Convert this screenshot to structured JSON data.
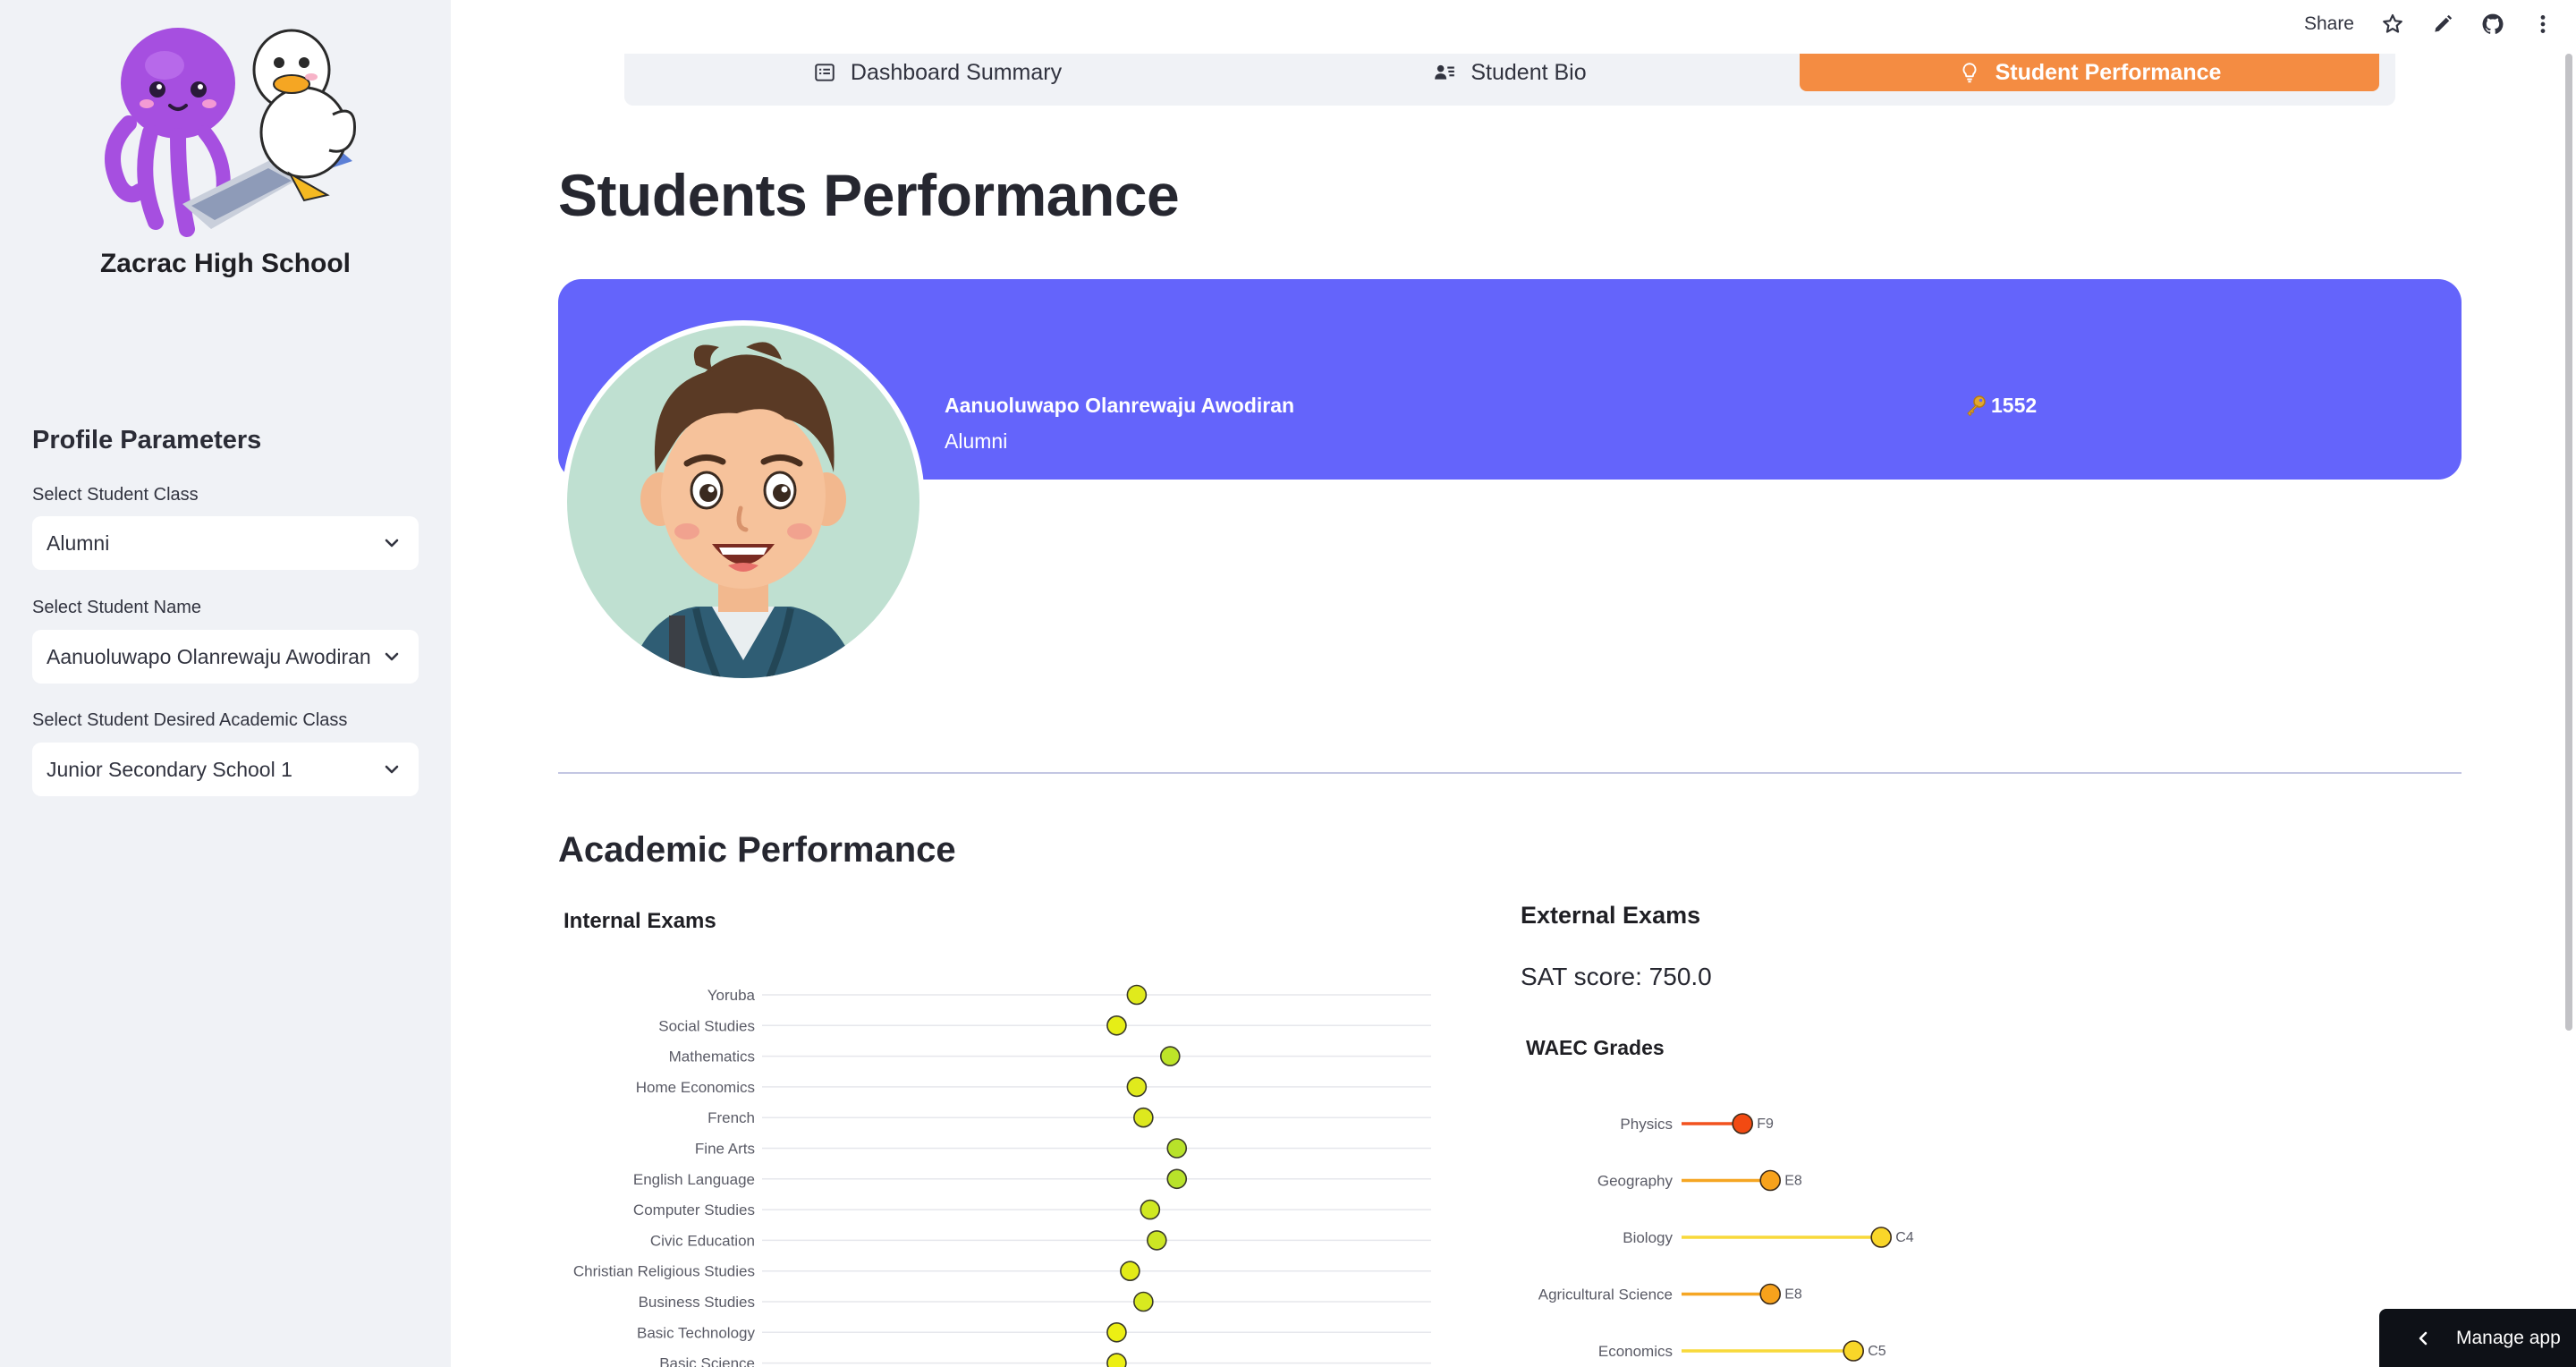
{
  "sidebar": {
    "school_name": "Zacrac High School",
    "profile_heading": "Profile Parameters",
    "fields": [
      {
        "label": "Select Student Class",
        "value": "Alumni"
      },
      {
        "label": "Select Student Name",
        "value": "Aanuoluwapo Olanrewaju Awodiran"
      },
      {
        "label": "Select Student Desired Academic Class",
        "value": "Junior Secondary School 1"
      }
    ]
  },
  "toolbar": {
    "share_label": "Share",
    "icons": [
      "star-icon",
      "edit-icon",
      "github-icon",
      "more-icon"
    ]
  },
  "tabs": [
    {
      "label": "Dashboard Summary",
      "icon": "summary-icon",
      "active": false
    },
    {
      "label": "Student Bio",
      "icon": "bio-icon",
      "active": false
    },
    {
      "label": "Student Performance",
      "icon": "lightbulb-icon",
      "active": true
    }
  ],
  "page": {
    "title": "Students Performance"
  },
  "profile": {
    "name": "Aanuoluwapo Olanrewaju Awodiran",
    "class": "Alumni",
    "student_id": "1552",
    "card_color": "#6464fb"
  },
  "academic": {
    "heading": "Academic Performance",
    "internal_title": "Internal Exams",
    "external_title": "External Exams",
    "sat_score": "SAT score: 750.0",
    "waec_title": "WAEC Grades"
  },
  "manage_app_label": "Manage app",
  "colors": {
    "accent_tab": "#f48c42",
    "sidebar_bg": "#f0f2f6"
  },
  "chart_data": [
    {
      "type": "scatter",
      "title": "Internal Exams",
      "xlim": [
        0,
        100
      ],
      "categories": [
        "Yoruba",
        "Social Studies",
        "Mathematics",
        "Home Economics",
        "French",
        "Fine Arts",
        "English Language",
        "Computer Studies",
        "Civic Education",
        "Christian Religious Studies",
        "Business Studies",
        "Basic Technology",
        "Basic Science"
      ],
      "values": [
        56,
        53,
        61,
        56,
        57,
        62,
        62,
        58,
        59,
        55,
        57,
        53,
        53
      ],
      "marker_colors": [
        "#e0ea1c",
        "#e6ee16",
        "#bde428",
        "#e0ea1c",
        "#dde81e",
        "#b8e22a",
        "#b8e22a",
        "#d0e822",
        "#cce624",
        "#e3eb18",
        "#d8e920",
        "#ecef14",
        "#ecef14"
      ]
    },
    {
      "type": "lollipop",
      "title": "WAEC Grades",
      "xlim": [
        0,
        10
      ],
      "categories": [
        "Physics",
        "Geography",
        "Biology",
        "Agricultural Science",
        "Economics"
      ],
      "grades": [
        "F9",
        "E8",
        "C4",
        "E8",
        "C5"
      ],
      "values": [
        1.1,
        1.6,
        3.6,
        1.6,
        3.1
      ],
      "colors": [
        "#f2521f",
        "#f5a623",
        "#f8d93a",
        "#f5a623",
        "#f8d93a"
      ],
      "marker_colors": [
        "#f24a12",
        "#f7a21c",
        "#f9d629",
        "#f7a21c",
        "#f9d629"
      ]
    }
  ]
}
